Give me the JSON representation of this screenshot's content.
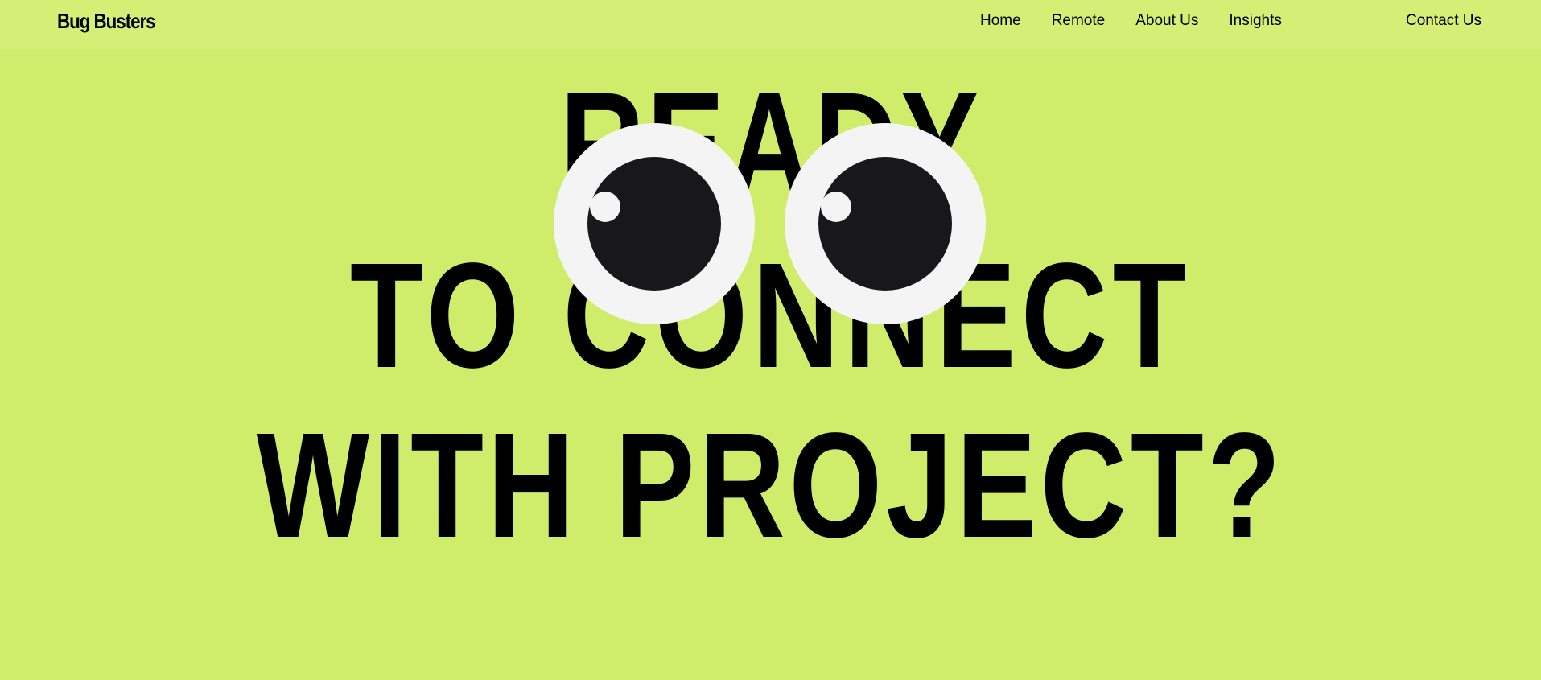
{
  "header": {
    "logo": "Bug Busters",
    "nav": [
      {
        "label": "Home"
      },
      {
        "label": "Remote"
      },
      {
        "label": "About Us"
      },
      {
        "label": "Insights"
      }
    ],
    "contact_label": "Contact Us"
  },
  "hero": {
    "line1": "READY",
    "line2": "TO CONNECT",
    "line3": "WITH PROJECT?"
  },
  "colors": {
    "background": "#cfec6b",
    "text": "#000000",
    "eye_white": "#f4f4f4",
    "pupil": "#18181a"
  },
  "icons": [
    "googly-eye-left-icon",
    "googly-eye-right-icon"
  ]
}
